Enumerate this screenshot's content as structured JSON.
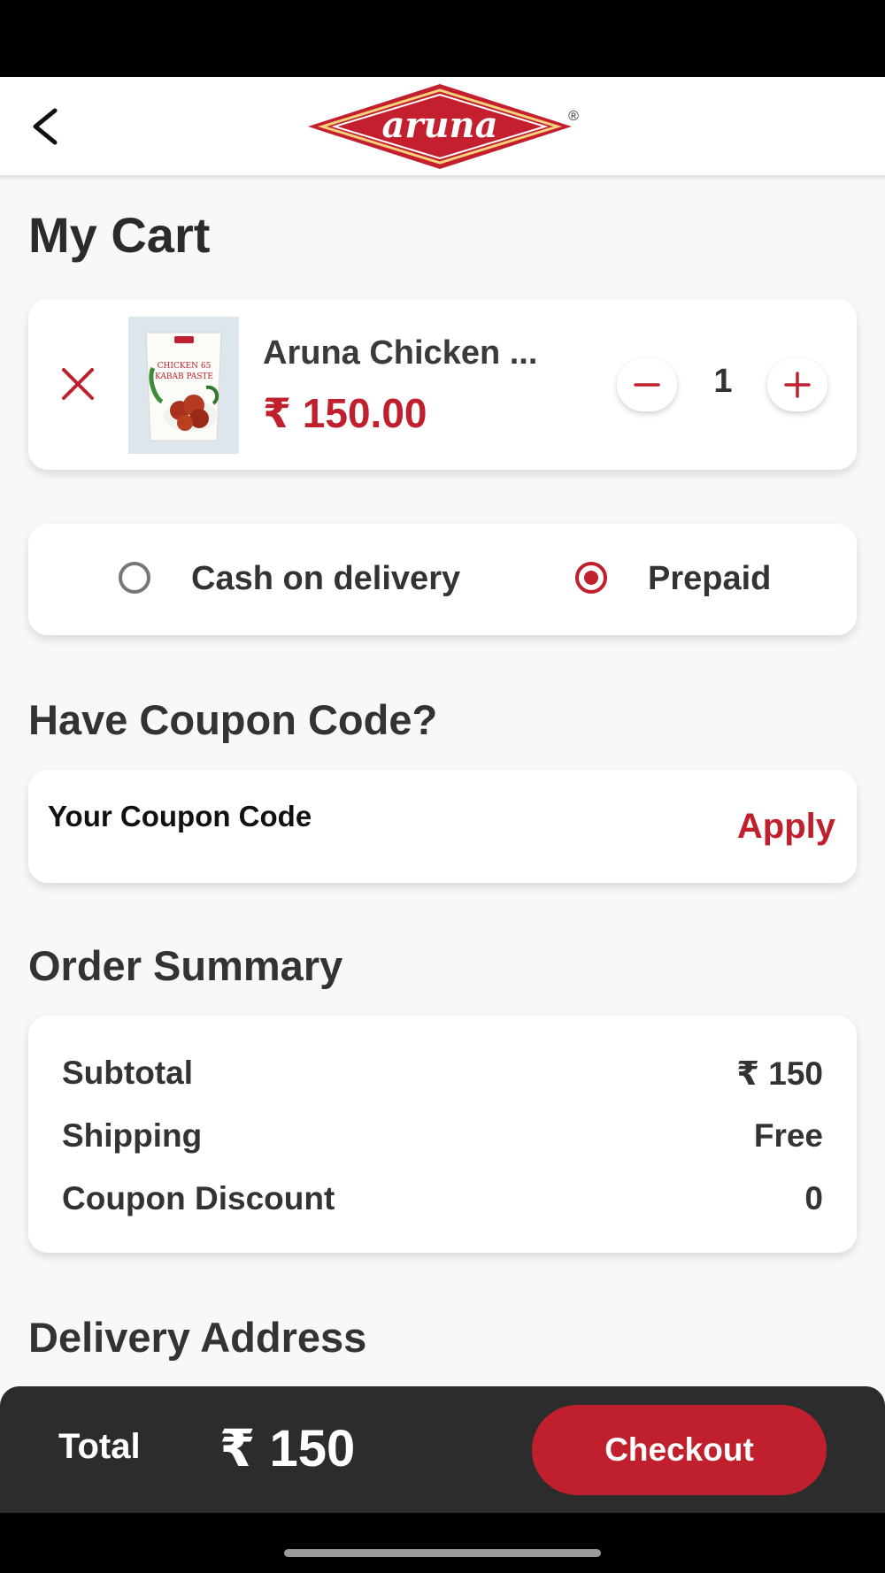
{
  "header": {
    "back_icon": "chevron-left-icon",
    "logo_text": "aruna",
    "logo_mark": "®"
  },
  "page": {
    "title": "My Cart"
  },
  "cart": {
    "items": [
      {
        "name": "Aruna Chicken ...",
        "price": "₹ 150.00",
        "quantity": "1",
        "image_text_1": "CHICKEN 65",
        "image_text_2": "KABAB PASTE"
      }
    ]
  },
  "payment": {
    "options": [
      {
        "label": "Cash on delivery",
        "selected": false
      },
      {
        "label": "Prepaid",
        "selected": true
      }
    ]
  },
  "coupon": {
    "title": "Have Coupon Code?",
    "placeholder": "Your Coupon Code",
    "apply_label": "Apply"
  },
  "summary": {
    "title": "Order Summary",
    "rows": [
      {
        "label": "Subtotal",
        "value": "₹ 150"
      },
      {
        "label": "Shipping",
        "value": "Free"
      },
      {
        "label": "Coupon Discount",
        "value": "0"
      }
    ]
  },
  "address": {
    "title": "Delivery Address"
  },
  "footer": {
    "total_label": "Total",
    "total_value": "₹ 150",
    "checkout_label": "Checkout"
  },
  "colors": {
    "accent": "#c0202e",
    "footer_bg": "#2c2c2c",
    "page_bg": "#f8f8f8"
  }
}
